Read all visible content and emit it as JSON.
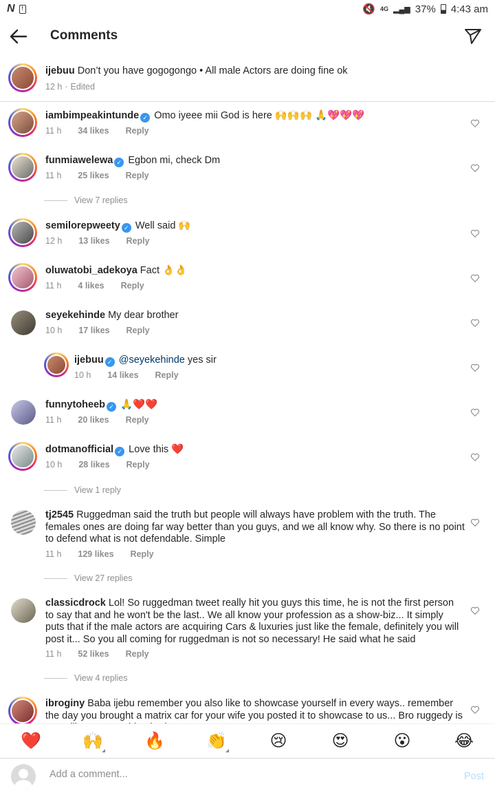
{
  "status_bar": {
    "left_logo": "N",
    "left_sim": "!",
    "network": "4G",
    "battery": "37%",
    "time": "4:43 am"
  },
  "header": {
    "title": "Comments",
    "back_icon": "arrow-left-icon",
    "send_icon": "send-icon"
  },
  "caption": {
    "user": "ijebuu",
    "text": "Don’t you have gogogongo • All male Actors are doing fine ok",
    "time": "12 h",
    "edited": "Edited"
  },
  "comments": [
    {
      "user": "iambimpeakintunde",
      "verified": true,
      "text": "Omo iyeee mii God is here 🙌🙌🙌 🙏💖💖💖",
      "time": "11 h",
      "likes": "34 likes",
      "reply": "Reply"
    },
    {
      "user": "funmiawelewa",
      "verified": true,
      "text": "Egbon mi, check Dm",
      "time": "11 h",
      "likes": "25 likes",
      "reply": "Reply"
    },
    {
      "user": "semilorepweety",
      "verified": true,
      "text": "Well said 🙌",
      "time": "12 h",
      "likes": "13 likes",
      "reply": "Reply"
    },
    {
      "user": "oluwatobi_adekoya",
      "verified": false,
      "text": "Fact 👌👌",
      "time": "11 h",
      "likes": "4 likes",
      "reply": "Reply"
    },
    {
      "user": "seyekehinde",
      "verified": false,
      "text": "My dear brother",
      "time": "10 h",
      "likes": "17 likes",
      "reply": "Reply"
    },
    {
      "user": "ijebuu",
      "verified": true,
      "mention": "@seyekehinde",
      "text": " yes sir",
      "time": "10 h",
      "likes": "14 likes",
      "reply": "Reply"
    },
    {
      "user": "funnytoheeb",
      "verified": true,
      "text": "🙏❤️❤️",
      "time": "11 h",
      "likes": "20 likes",
      "reply": "Reply"
    },
    {
      "user": "dotmanofficial",
      "verified": true,
      "text": "Love this ❤️",
      "time": "10 h",
      "likes": "28 likes",
      "reply": "Reply"
    },
    {
      "user": "tj2545",
      "verified": false,
      "text": "Ruggedman said the truth but people will always have problem with the truth. The females ones are doing far way better than you guys, and we all know why. So there is no point to defend what is not defendable. Simple",
      "time": "11 h",
      "likes": "129 likes",
      "reply": "Reply"
    },
    {
      "user": "classicdrock",
      "verified": false,
      "text": "Lol! So ruggedman tweet really hit you guys this time, he is not the first person to say that and he won't be the last.. We all know your profession as a show-biz... It simply puts that if the male actors are acquiring Cars & luxuries just like the female, definitely you will post it... So you all coming for ruggedman is not so necessary!  He said what he said",
      "time": "11 h",
      "likes": "52 likes",
      "reply": "Reply"
    },
    {
      "user": "ibroginy",
      "verified": false,
      "text": "Baba ijebu remember you also like to showcase yourself in every ways.. remember the day you brought a matrix car for your wife you posted it to showcase to us... Bro ruggedy is not telling you anything bad..."
    }
  ],
  "view_replies": {
    "funmiawelewa": "View 7 replies",
    "dotmanofficial": "View 1 reply",
    "tj2545": "View 27 replies",
    "classicdrock": "View 4 replies"
  },
  "emoji_bar": [
    "❤️",
    "🙌",
    "🔥",
    "👏",
    "😢",
    "😍",
    "😮",
    "😂"
  ],
  "input": {
    "placeholder": "Add a comment...",
    "post_label": "Post"
  },
  "colors": {
    "accent_blue": "#3897f0",
    "post_disabled": "#b2dffc",
    "meta_gray": "#8e8e8e"
  }
}
